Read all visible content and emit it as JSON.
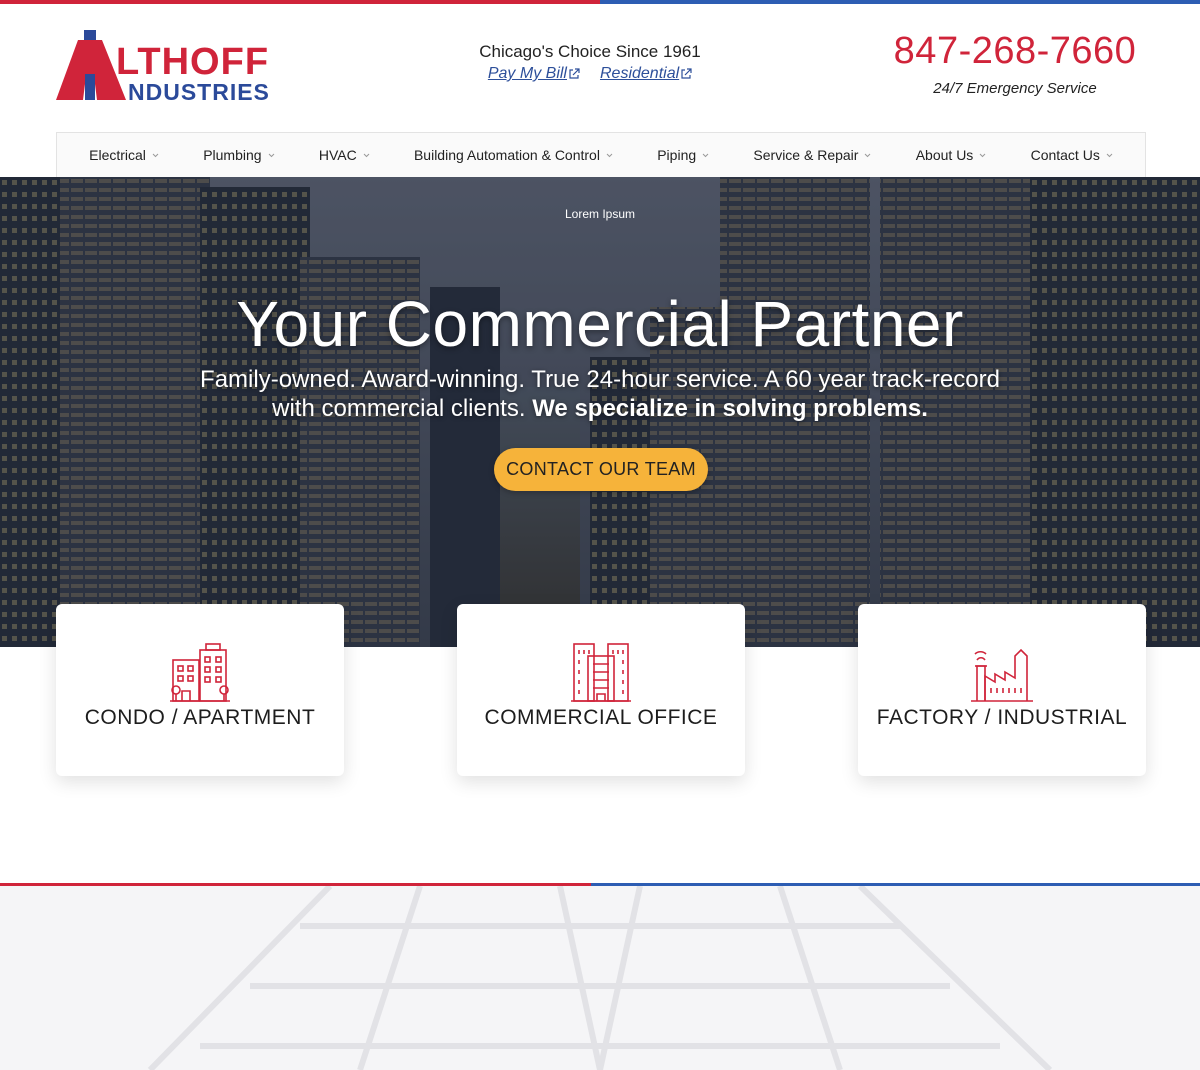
{
  "header": {
    "logo_text_top": "LTHOFF",
    "logo_text_bottom": "NDUSTRIES",
    "tagline": "Chicago's Choice Since 1961",
    "links": [
      {
        "label": "Pay My Bill"
      },
      {
        "label": "Residential"
      }
    ],
    "phone": "847-268-7660",
    "emergency": "24/7 Emergency Service"
  },
  "nav": {
    "items": [
      {
        "label": "Electrical"
      },
      {
        "label": "Plumbing"
      },
      {
        "label": "HVAC"
      },
      {
        "label": "Building Automation & Control"
      },
      {
        "label": "Piping"
      },
      {
        "label": "Service & Repair"
      },
      {
        "label": "About Us"
      },
      {
        "label": "Contact Us"
      }
    ]
  },
  "hero": {
    "kicker": "Lorem Ipsum",
    "title": "Your Commercial Partner",
    "subtitle_plain": "Family-owned. Award-winning. True 24-hour service. A 60 year track-record with commercial clients.",
    "subtitle_bold": "We specialize in solving problems.",
    "cta_label": "CONTACT OUR TEAM"
  },
  "cards": [
    {
      "label": "CONDO / APARTMENT",
      "icon": "apartment-buildings-icon"
    },
    {
      "label": "COMMERCIAL OFFICE",
      "icon": "office-building-icon"
    },
    {
      "label": "FACTORY / INDUSTRIAL",
      "icon": "factory-icon"
    }
  ],
  "colors": {
    "brand_red": "#d0243a",
    "brand_blue": "#2d5db3",
    "cta_yellow": "#f6b33a"
  }
}
